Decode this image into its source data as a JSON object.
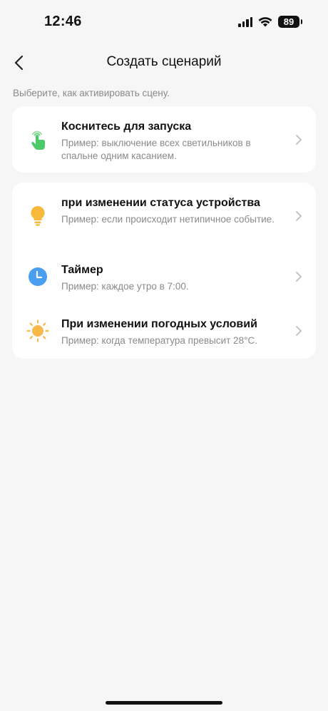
{
  "status_bar": {
    "time": "12:46",
    "battery": "89"
  },
  "nav": {
    "title": "Создать сценарий"
  },
  "subtitle": "Выберите, как активировать сцену.",
  "cards": {
    "manual": {
      "title": "Коснитесь для запуска",
      "desc": "Пример: выключение всех светильников в спальне одним касанием.",
      "icon": "tap-hand-icon",
      "color": "#4cca6a"
    },
    "device": {
      "title": "при изменении статуса устройства",
      "desc": "Пример: если происходит нетипичное событие.",
      "icon": "lightbulb-icon",
      "color": "#f6b93b"
    },
    "timer": {
      "title": "Таймер",
      "desc": "Пример: каждое утро в 7:00.",
      "icon": "clock-icon",
      "color": "#4a9ef0"
    },
    "weather": {
      "title": "При изменении погодных условий",
      "desc": "Пример: когда температура превысит 28°C.",
      "icon": "sun-icon",
      "color": "#f7b94a"
    }
  }
}
